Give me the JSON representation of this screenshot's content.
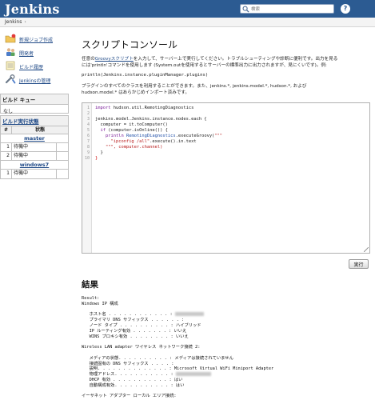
{
  "header": {
    "logo": "Jenkins",
    "search_placeholder": "検索",
    "help_label": "?"
  },
  "breadcrumb": {
    "items": [
      {
        "label": "Jenkins"
      }
    ],
    "separator": "›"
  },
  "sidebar": {
    "tasks": [
      {
        "label": "新規ジョブ作成",
        "icon": "new-job-icon"
      },
      {
        "label": "開発者",
        "icon": "people-icon"
      },
      {
        "label": "ビルド履歴",
        "icon": "notepad-icon"
      },
      {
        "label": "Jenkinsの管理",
        "icon": "wrench-icon"
      }
    ],
    "build_queue": {
      "title": "ビルド キュー",
      "empty_text": "なし"
    },
    "executors": {
      "title": "ビルド実行状態",
      "col_number": "#",
      "col_status": "状態",
      "nodes": [
        {
          "name": "master",
          "rows": [
            {
              "num": "1",
              "status": "待機中"
            },
            {
              "num": "2",
              "status": "待機中"
            }
          ]
        },
        {
          "name": "windows7",
          "rows": [
            {
              "num": "1",
              "status": "待機中"
            }
          ]
        }
      ]
    }
  },
  "main": {
    "title": "スクリプトコンソール",
    "intro_prefix": "任意の",
    "intro_link": "Groovyスクリプト",
    "intro_line1_rest": "を入力して、サーバー上で実行してください。トラブルシューティングや診断に便利です。出力を見る",
    "intro_line2": "には'println'コマンドを使用します (System.outを使用するとサーバーの標準出力に出力されますが、見にくいです)。例:",
    "example_code": "println(Jenkins.instance.pluginManager.plugins)",
    "imports_line1": "プラグインのすべてのクラスを利用することができます。また、jenkins.*, jenkins.model.*, hudson.*, および",
    "imports_line2": "hudson.model.* はあらかじめインポート済みです。",
    "code": {
      "line_numbers": [
        "1",
        "2",
        "3",
        "4",
        "5",
        "6",
        "7",
        "8",
        "9",
        "10"
      ],
      "l1_kw": "import",
      "l1_rest": " hudson.util.RemotingDiagnostics",
      "l3": "jenkins.model.Jenkins.instance.nodes.each {",
      "l4": "  computer = it.toComputer()",
      "l5_kw": "  if",
      "l5_rest": " (computer.isOnline()) {",
      "l6_a": "    println ",
      "l6_cls": "RemotingDiagnostics",
      "l6_b": ".executeGroovy(",
      "l6_str": "\"\"\"",
      "l7_str": "      \"ipconfig /all\"",
      "l7_rest": ".execute().in.text",
      "l8_str": "    \"\"\"",
      "l8_rest": ", computer.channel)",
      "l9": "  }",
      "l10": "}"
    },
    "run_button": "実行",
    "result_title": "結果",
    "result": {
      "l1": "Result:",
      "l2": "Windows IP 構成",
      "l4": "   ホスト名 . . . . . . . . . . . . : ",
      "l5": "   プライマリ DNS サフィックス . . . . . . : ",
      "l6": "   ノード タイプ . . . . . . . . . . : ハイブリッド",
      "l7": "   IP ルーティング有効 . . . . . . . : いいえ",
      "l8": "   WINS プロキシ有効 . . . . . . . . : いいえ",
      "l10": "Wireless LAN adapter ワイヤレス ネットワーク接続 2:",
      "l12": "   メディアの状態. . . . . . . . . . : メディアは接続されていません",
      "l13": "   接続固有の DNS サフィックス . . . . : ",
      "l14": "   説明. . . . . . . . . . . . . . : Microsoft Virtual WiFi Miniport Adapter",
      "l15": "   物理アドレス. . . . . . . . . . . : ",
      "l16": "   DHCP 有効 . . . . . . . . . . . : はい",
      "l17": "   自動構成有効. . . . . . . . . . . : はい",
      "l19": "イーサネット アダプター ローカル エリア接続:"
    }
  }
}
